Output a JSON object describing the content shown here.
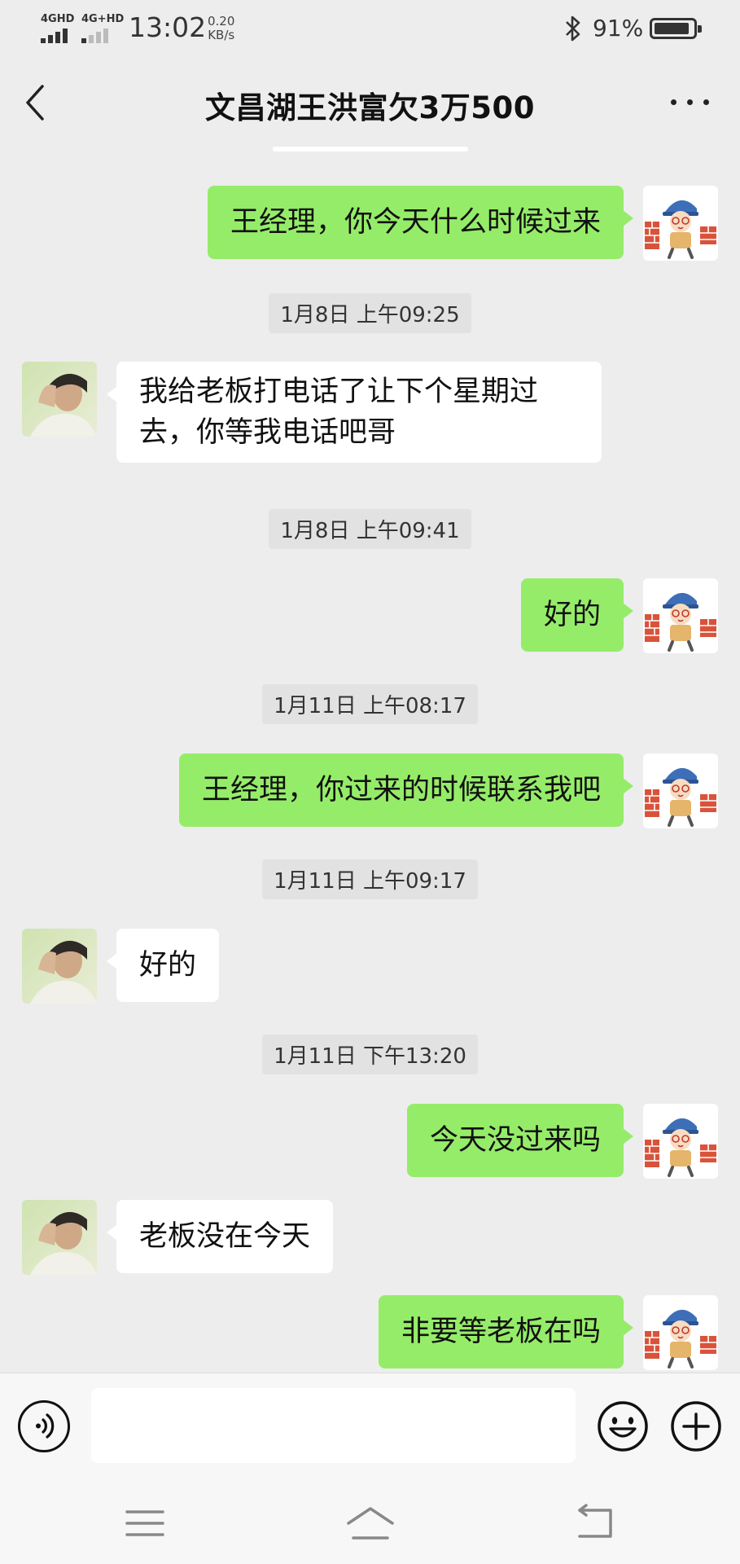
{
  "status_bar": {
    "network1": "4GHD",
    "network2": "4G+HD",
    "time": "13:02",
    "speed_value": "0.20",
    "speed_unit": "KB/s",
    "battery_percent": "91%",
    "battery_level": 0.91
  },
  "header": {
    "title": "文昌湖王洪富欠3万500"
  },
  "input": {
    "value": ""
  },
  "messages": [
    {
      "dir": "out",
      "text": "王经理，你今天什么时候过来"
    },
    {
      "time": "1月8日 上午09:25"
    },
    {
      "dir": "in",
      "text": "我给老板打电话了让下个星期过去，你等我电话吧哥"
    },
    {
      "time": "1月8日 上午09:41"
    },
    {
      "dir": "out",
      "text": "好的"
    },
    {
      "time": "1月11日 上午08:17"
    },
    {
      "dir": "out",
      "text": "王经理，你过来的时候联系我吧"
    },
    {
      "time": "1月11日 上午09:17"
    },
    {
      "dir": "in",
      "text": "好的"
    },
    {
      "time": "1月11日 下午13:20"
    },
    {
      "dir": "out",
      "text": "今天没过来吗"
    },
    {
      "dir": "in",
      "text": "老板没在今天"
    },
    {
      "dir": "out",
      "text": "非要等老板在吗"
    }
  ],
  "colors": {
    "background": "#ededed",
    "outgoing_bubble": "#95ec69",
    "incoming_bubble": "#ffffff"
  },
  "icons": {
    "back": "chevron-left-icon",
    "more": "more-dots-icon",
    "voice": "voice-icon",
    "emoji": "emoji-icon",
    "plus": "plus-icon"
  }
}
